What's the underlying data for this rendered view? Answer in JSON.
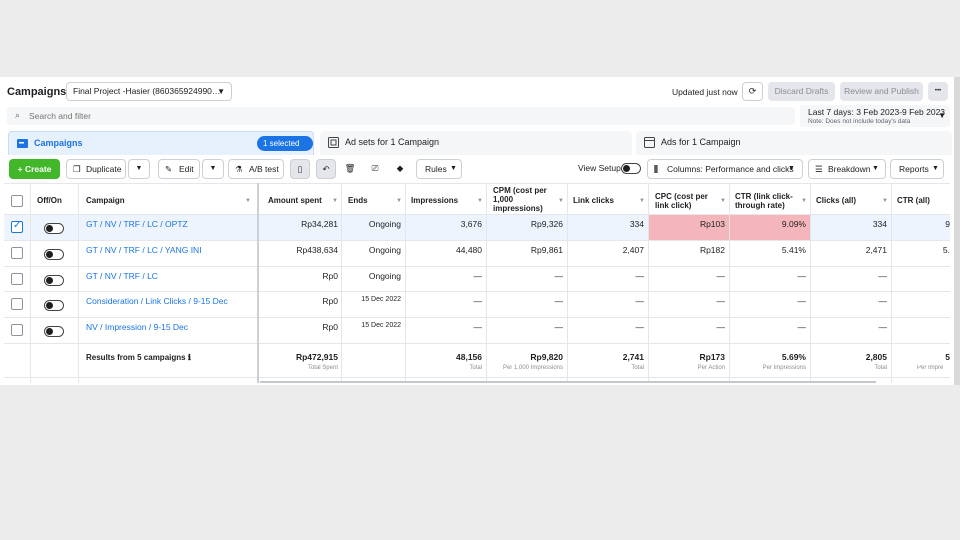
{
  "header": {
    "title": "Campaigns",
    "account_name": "Final Project -Hasier (860365924990…",
    "updated_text": "Updated just now",
    "discard_label": "Discard Drafts",
    "review_label": "Review and Publish",
    "more_label": "•••"
  },
  "search": {
    "placeholder": "Search and filter"
  },
  "date_range": {
    "label": "Last 7 days: 3 Feb 2023-9 Feb 2023",
    "note": "Note: Does not include today's data"
  },
  "tabs": {
    "campaigns": "Campaigns",
    "selected_badge": "1 selected",
    "ad_sets": "Ad sets for 1 Campaign",
    "ads": "Ads for 1 Campaign"
  },
  "toolbar": {
    "create": "Create",
    "duplicate": "Duplicate",
    "edit": "Edit",
    "ab_test": "A/B test",
    "rules": "Rules",
    "view_setup": "View Setup",
    "columns": "Columns: Performance and clicks",
    "breakdown": "Breakdown",
    "reports": "Reports"
  },
  "columns": {
    "off_on": "Off/On",
    "campaign": "Campaign",
    "amount_spent": "Amount spent",
    "ends": "Ends",
    "impressions": "Impressions",
    "cpm": [
      "CPM (cost per",
      "1,000",
      "impressions)"
    ],
    "link_clicks": "Link clicks",
    "cpc": [
      "CPC (cost per",
      "link click)"
    ],
    "ctr_link": [
      "CTR (link click-",
      "through rate)"
    ],
    "clicks_all": "Clicks (all)",
    "ctr_all": "CTR (all)"
  },
  "rows": [
    {
      "name": "GT / NV / TRF / LC / OPTZ",
      "amount": "Rp34,281",
      "ends": "Ongoing",
      "impressions": "3,676",
      "cpm": "Rp9,326",
      "link_clicks": "334",
      "cpc": "Rp103",
      "ctr_link": "9.09%",
      "clicks_all": "334",
      "ctr_all": "9"
    },
    {
      "name": "GT / NV / TRF / LC / YANG INI",
      "amount": "Rp438,634",
      "ends": "Ongoing",
      "impressions": "44,480",
      "cpm": "Rp9,861",
      "link_clicks": "2,407",
      "cpc": "Rp182",
      "ctr_link": "5.41%",
      "clicks_all": "2,471",
      "ctr_all": "5."
    },
    {
      "name": "GT / NV / TRF / LC",
      "amount": "Rp0",
      "ends": "Ongoing",
      "impressions": "—",
      "cpm": "—",
      "link_clicks": "—",
      "cpc": "—",
      "ctr_link": "—",
      "clicks_all": "—",
      "ctr_all": ""
    },
    {
      "name": "Consideration / Link Clicks / 9-15 Dec",
      "amount": "Rp0",
      "ends": "15 Dec 2022",
      "impressions": "—",
      "cpm": "—",
      "link_clicks": "—",
      "cpc": "—",
      "ctr_link": "—",
      "clicks_all": "—",
      "ctr_all": ""
    },
    {
      "name": "NV / Impression / 9-15 Dec",
      "amount": "Rp0",
      "ends": "15 Dec 2022",
      "impressions": "—",
      "cpm": "—",
      "link_clicks": "—",
      "cpc": "—",
      "ctr_link": "—",
      "clicks_all": "—",
      "ctr_all": ""
    }
  ],
  "totals": {
    "label": "Results from 5 campaigns",
    "amount": "Rp472,915",
    "amount_sub": "Total Spent",
    "impressions": "48,156",
    "impressions_sub": "Total",
    "cpm": "Rp9,820",
    "cpm_sub": "Per 1,000 Impressions",
    "link_clicks": "2,741",
    "link_clicks_sub": "Total",
    "cpc": "Rp173",
    "cpc_sub": "Per Action",
    "ctr_link": "5.69%",
    "ctr_link_sub": "Per Impressions",
    "clicks_all": "2,805",
    "clicks_all_sub": "Total",
    "ctr_all": "5",
    "ctr_all_sub": "Per Impre"
  },
  "colors": {
    "accent": "#1b74e4",
    "create": "#42b72a",
    "highlight": "#f4b6bb"
  }
}
